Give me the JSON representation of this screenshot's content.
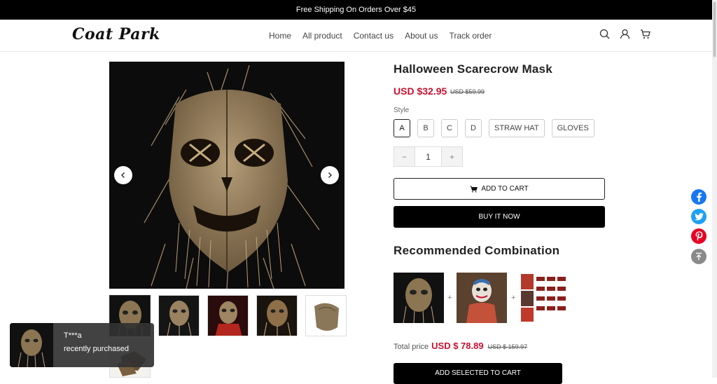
{
  "announcement": "Free Shipping On Orders Over $45",
  "header": {
    "logo": "Coat Park",
    "nav": [
      "Home",
      "All product",
      "Contact us",
      "About us",
      "Track order"
    ],
    "icons": [
      "search-icon",
      "account-icon",
      "cart-icon"
    ]
  },
  "product": {
    "title": "Halloween Scarecrow Mask",
    "price": "USD $32.95",
    "old_price": "USD $59.99",
    "style_label": "Style",
    "style_options": [
      "A",
      "B",
      "C",
      "D",
      "STRAW HAT",
      "GLOVES"
    ],
    "selected_style": "A",
    "quantity": "1",
    "qty_minus": "−",
    "qty_plus": "+",
    "add_to_cart": "ADD TO CART",
    "buy_now": "BUY IT NOW"
  },
  "recommended": {
    "title": "Recommended Combination",
    "plus": "+",
    "total_label": "Total price",
    "total_price": "USD $ 78.89",
    "total_old_price": "USD $ 159.97",
    "add_selected": "ADD SELECTED TO CART"
  },
  "social": [
    "facebook-icon",
    "twitter-icon",
    "pinterest-icon",
    "back-to-top-icon"
  ],
  "toast": {
    "name": "T***a",
    "message": "recently purchased"
  },
  "colors": {
    "accent_red": "#c8102e",
    "black": "#000000",
    "facebook": "#1877f2",
    "twitter": "#1da1f2",
    "pinterest": "#e60023"
  }
}
